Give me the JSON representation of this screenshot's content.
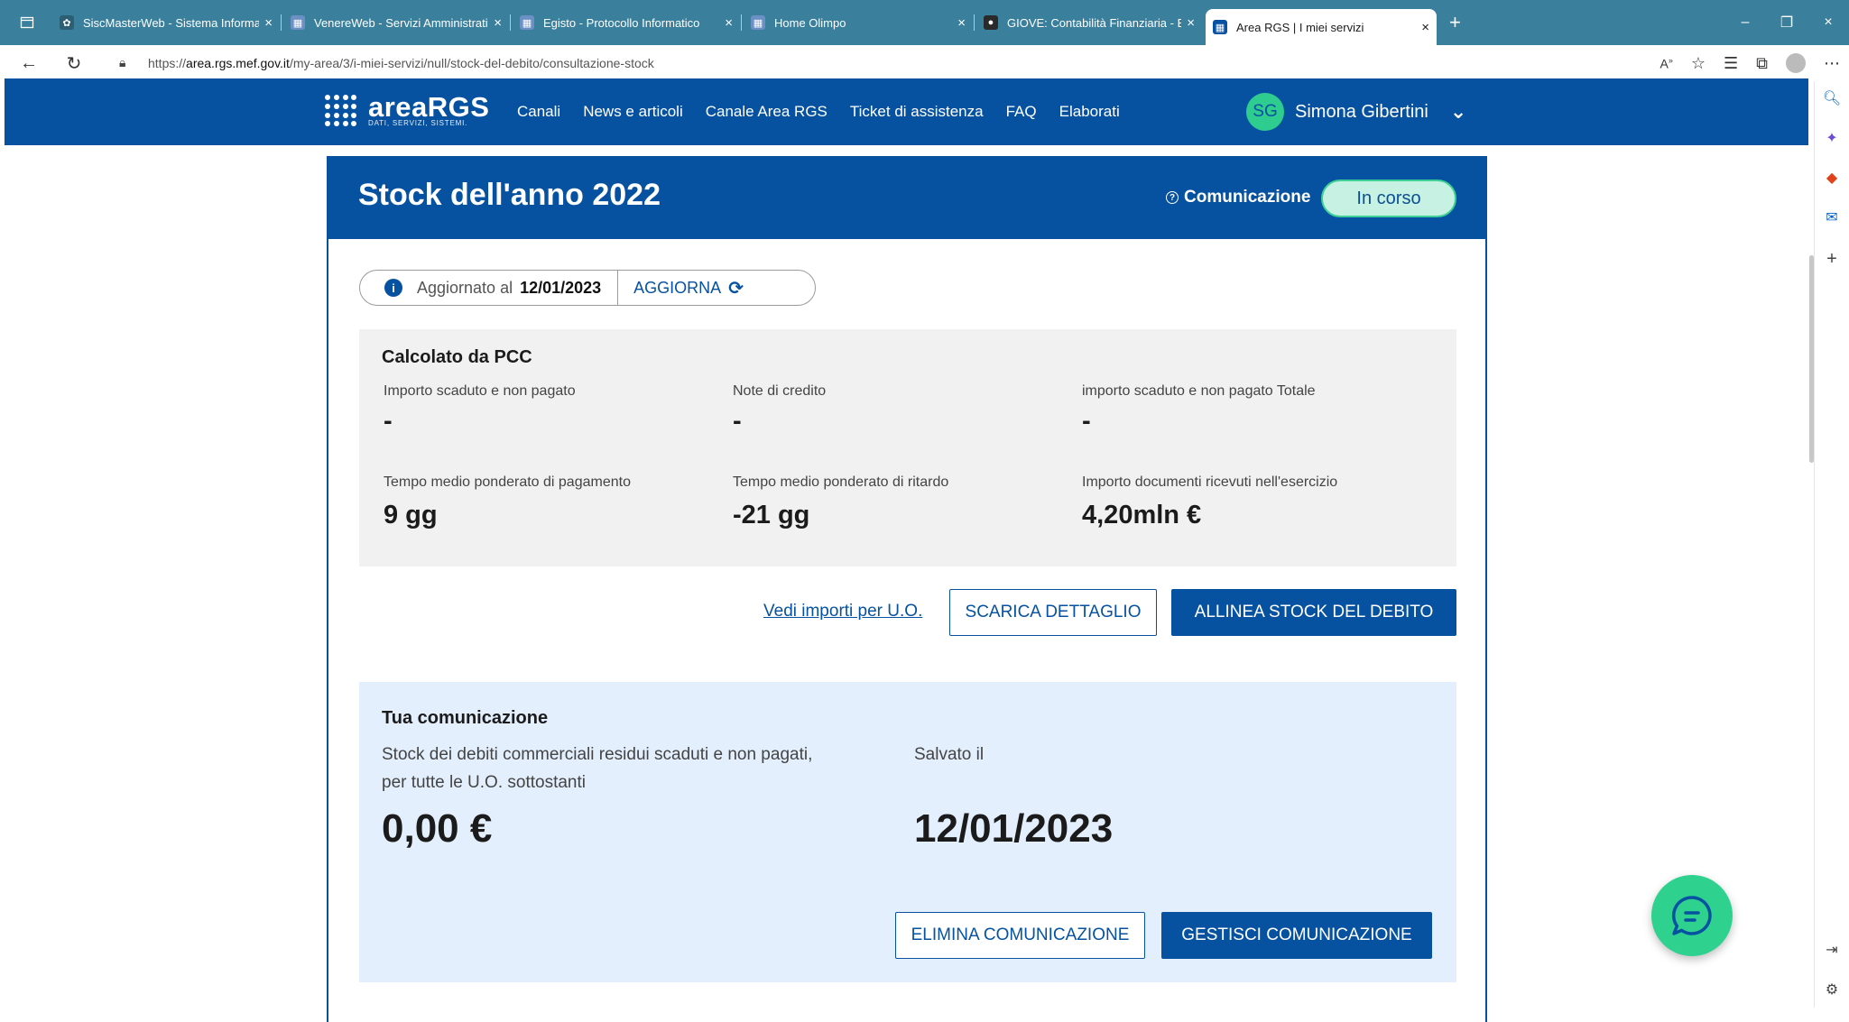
{
  "browser": {
    "tabs": [
      {
        "title": "SiscMasterWeb - Sistema Informativo",
        "fav_color": "#3a7f9c"
      },
      {
        "title": "VenereWeb - Servizi Amministrativi",
        "fav_color": "#4a6fa5"
      },
      {
        "title": "Egisto - Protocollo Informatico",
        "fav_color": "#4a6fa5"
      },
      {
        "title": "Home Olimpo",
        "fav_color": "#4a6fa5"
      },
      {
        "title": "GIOVE: Contabilità Finanziaria - E",
        "fav_color": "#2a2a2a"
      },
      {
        "title": "Area RGS | I miei servizi",
        "fav_color": "#0652a1"
      }
    ],
    "new_tab": "+",
    "url_prefix": "https://",
    "url_host": "area.rgs.mef.gov.it",
    "url_path": "/my-area/3/i-miei-servizi/null/stock-del-debito/consultazione-stock",
    "close_glyph": "×"
  },
  "header": {
    "logo_main": "areaRGS",
    "logo_sub": "DATI, SERVIZI, SISTEMI.",
    "nav": [
      "Canali",
      "News e articoli",
      "Canale Area RGS",
      "Ticket di assistenza",
      "FAQ",
      "Elaborati"
    ],
    "user_initials": "SG",
    "user_name": "Simona Gibertini"
  },
  "card": {
    "title": "Stock dell'anno 2022",
    "comm_label": "Comunicazione",
    "status": "In corso",
    "updated_label": "Aggiornato al",
    "updated_date": "12/01/2023",
    "refresh_label": "AGGIORNA"
  },
  "pcc": {
    "title": "Calcolato da PCC",
    "metrics": [
      {
        "label": "Importo scaduto e non pagato",
        "value": "-"
      },
      {
        "label": "Note di credito",
        "value": "-"
      },
      {
        "label": "importo scaduto e non pagato Totale",
        "value": "-"
      },
      {
        "label": "Tempo medio ponderato di pagamento",
        "value": "9 gg"
      },
      {
        "label": "Tempo medio ponderato di ritardo",
        "value": "-21 gg"
      },
      {
        "label": "Importo documenti ricevuti nell'esercizio",
        "value": "4,20mln €"
      }
    ]
  },
  "actions": {
    "link_uo": "Vedi importi per U.O.",
    "download": "SCARICA DETTAGLIO",
    "align": "ALLINEA STOCK DEL DEBITO"
  },
  "tua": {
    "title": "Tua comunicazione",
    "stock_label_1": "Stock dei debiti commerciali residui scaduti e non pagati,",
    "stock_label_2": "per tutte le U.O. sottostanti",
    "stock_value": "0,00 €",
    "saved_label": "Salvato il",
    "saved_value": "12/01/2023",
    "delete": "ELIMINA COMUNICAZIONE",
    "manage": "GESTISCI COMUNICAZIONE"
  }
}
